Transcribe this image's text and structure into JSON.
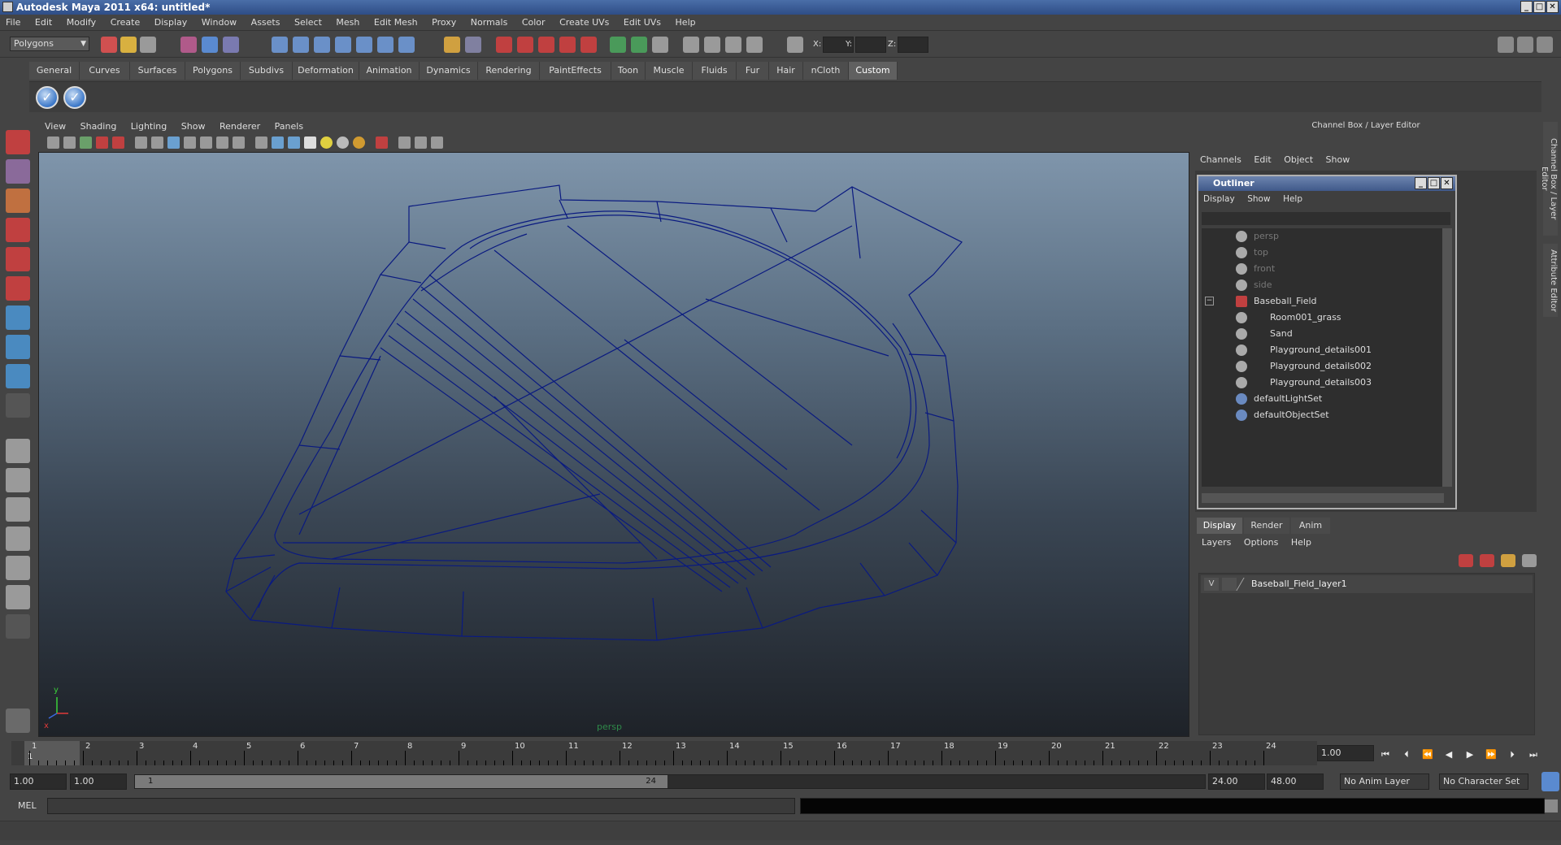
{
  "window": {
    "title": "Autodesk Maya 2011 x64: untitled*",
    "minimize": "_",
    "maximize": "□",
    "close": "✕"
  },
  "menubar": [
    "File",
    "Edit",
    "Modify",
    "Create",
    "Display",
    "Window",
    "Assets",
    "Select",
    "Mesh",
    "Edit Mesh",
    "Proxy",
    "Normals",
    "Color",
    "Create UVs",
    "Edit UVs",
    "Help"
  ],
  "statusline": {
    "mode": "Polygons",
    "x_label": "X:",
    "y_label": "Y:",
    "z_label": "Z:"
  },
  "shelf": {
    "tabs": [
      "General",
      "Curves",
      "Surfaces",
      "Polygons",
      "Subdivs",
      "Deformation",
      "Animation",
      "Dynamics",
      "Rendering",
      "PaintEffects",
      "Toon",
      "Muscle",
      "Fluids",
      "Fur",
      "Hair",
      "nCloth",
      "Custom"
    ],
    "active_tab": "Custom",
    "icon_glyph": "✓"
  },
  "panel": {
    "menu": [
      "View",
      "Shading",
      "Lighting",
      "Show",
      "Renderer",
      "Panels"
    ],
    "camera": "persp",
    "axis_x": "x",
    "axis_y": "y"
  },
  "channelbox": {
    "header": "Channel Box / Layer Editor",
    "menu": [
      "Channels",
      "Edit",
      "Object",
      "Show"
    ]
  },
  "outliner": {
    "title": "Outliner",
    "menu": [
      "Display",
      "Show",
      "Help"
    ],
    "items": [
      {
        "label": "persp",
        "dim": true
      },
      {
        "label": "top",
        "dim": true
      },
      {
        "label": "front",
        "dim": true
      },
      {
        "label": "side",
        "dim": true
      },
      {
        "label": "Baseball_Field",
        "dim": false
      },
      {
        "label": "Room001_grass",
        "dim": false
      },
      {
        "label": "Sand",
        "dim": false
      },
      {
        "label": "Playground_details001",
        "dim": false
      },
      {
        "label": "Playground_details002",
        "dim": false
      },
      {
        "label": "Playground_details003",
        "dim": false
      },
      {
        "label": "defaultLightSet",
        "dim": false
      },
      {
        "label": "defaultObjectSet",
        "dim": false
      }
    ]
  },
  "layers": {
    "tabs": [
      "Display",
      "Render",
      "Anim"
    ],
    "menu": [
      "Layers",
      "Options",
      "Help"
    ],
    "row": {
      "visible": "V",
      "name": "Baseball_Field_layer1"
    }
  },
  "sidetabs": [
    "Channel Box / Layer Editor",
    "Attribute Editor"
  ],
  "timeslider": {
    "frames": [
      "1",
      "2",
      "3",
      "4",
      "5",
      "6",
      "7",
      "8",
      "9",
      "10",
      "11",
      "12",
      "13",
      "14",
      "15",
      "16",
      "17",
      "18",
      "19",
      "20",
      "21",
      "22",
      "23",
      "24"
    ],
    "current_marker": "1",
    "current_frame": "1.00"
  },
  "range": {
    "start": "1.00",
    "playback_start": "1.00",
    "thumb_start": "1",
    "thumb_end": "24",
    "playback_end": "24.00",
    "end": "48.00",
    "anim_layer": "No Anim Layer",
    "character_set": "No Character Set"
  },
  "cmdline": {
    "label": "MEL"
  },
  "colors": {
    "accent": "#3b77c8",
    "wire": "#0a1a80",
    "title": "#2e4d86"
  }
}
